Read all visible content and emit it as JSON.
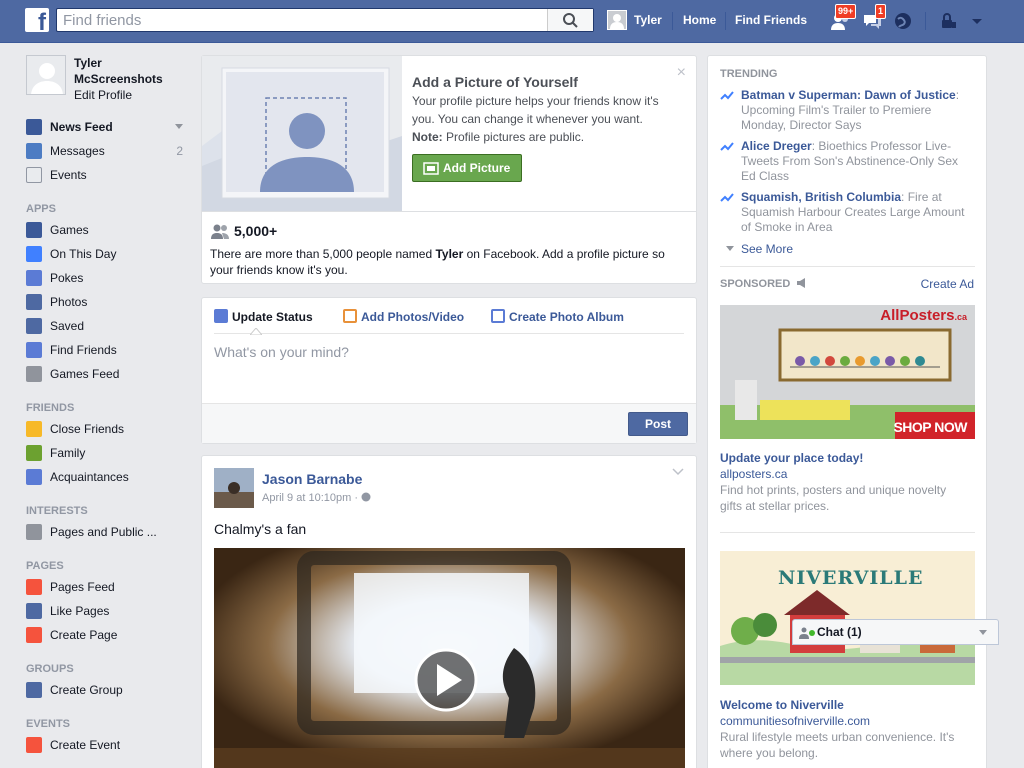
{
  "topbar": {
    "logo": "f",
    "search_placeholder": "Find friends",
    "user": "Tyler",
    "home": "Home",
    "find_friends": "Find Friends",
    "friend_requests_badge": "99+",
    "messages_badge": "1"
  },
  "leftnav": {
    "name": "Tyler McScreenshots",
    "edit_profile": "Edit Profile",
    "favorites": [
      {
        "label": "News Feed",
        "icon": "news-feed-icon",
        "color": "#3b5998"
      },
      {
        "label": "Messages",
        "count": "2",
        "icon": "messages-icon",
        "color": "#4d7cc3"
      },
      {
        "label": "Events",
        "icon": "calendar-icon",
        "color": "#e9ebee"
      }
    ],
    "apps_heading": "APPS",
    "apps": [
      {
        "label": "Games",
        "icon": "games-icon",
        "color": "#3b5998"
      },
      {
        "label": "On This Day",
        "icon": "clock-icon",
        "color": "#4080ff"
      },
      {
        "label": "Pokes",
        "icon": "poke-icon",
        "color": "#5b7bd5"
      },
      {
        "label": "Photos",
        "icon": "photos-icon",
        "color": "#4e69a2"
      },
      {
        "label": "Saved",
        "icon": "bookmark-icon",
        "color": "#4e69a2"
      },
      {
        "label": "Find Friends",
        "icon": "find-friends-icon",
        "color": "#5b7bd5"
      },
      {
        "label": "Games Feed",
        "icon": "gamepad-icon",
        "color": "#90949c"
      }
    ],
    "friends_heading": "FRIENDS",
    "friends": [
      {
        "label": "Close Friends",
        "icon": "star-icon",
        "color": "#f7b928"
      },
      {
        "label": "Family",
        "icon": "family-icon",
        "color": "#6ca130"
      },
      {
        "label": "Acquaintances",
        "icon": "acquaintances-icon",
        "color": "#5b7bd5"
      }
    ],
    "interests_heading": "INTERESTS",
    "interests": [
      {
        "label": "Pages and Public ...",
        "icon": "pages-public-icon",
        "color": "#90949c"
      }
    ],
    "pages_heading": "PAGES",
    "pages": [
      {
        "label": "Pages Feed",
        "icon": "megaphone-icon",
        "color": "#f5533d"
      },
      {
        "label": "Like Pages",
        "icon": "thumbs-up-icon",
        "color": "#4e69a2"
      },
      {
        "label": "Create Page",
        "icon": "plus-page-icon",
        "color": "#f5533d"
      }
    ],
    "groups_heading": "GROUPS",
    "groups": [
      {
        "label": "Create Group",
        "icon": "plus-group-icon",
        "color": "#4e69a2"
      }
    ],
    "events_heading": "EVENTS",
    "events": [
      {
        "label": "Create Event",
        "icon": "plus-event-icon",
        "color": "#f5533d"
      }
    ]
  },
  "addpic": {
    "title": "Add a Picture of Yourself",
    "desc": "Your profile picture helps your friends know it's you. You can change it whenever you want.",
    "note_label": "Note:",
    "note_text": " Profile pictures are public.",
    "button": "Add Picture",
    "close": "×",
    "count": "5,000+",
    "foot_pre": "There are more than 5,000 people named ",
    "foot_name": "Tyler",
    "foot_post": " on Facebook. Add a profile picture so your friends know it's you."
  },
  "composer": {
    "tab_status": "Update Status",
    "tab_photos": "Add Photos/Video",
    "tab_album": "Create Photo Album",
    "placeholder": "What's on your mind?",
    "post": "Post"
  },
  "post": {
    "author": "Jason Barnabe",
    "time": "April 9 at 10:10pm · ",
    "text": "Chalmy's a fan"
  },
  "right": {
    "trending_heading": "TRENDING",
    "trends": [
      {
        "title": "Batman v Superman: Dawn of Justice",
        "desc": ": Upcoming Film's Trailer to Premiere Monday, Director Says"
      },
      {
        "title": "Alice Dreger",
        "desc": ": Bioethics Professor Live-Tweets From Son's Abstinence-Only Sex Ed Class"
      },
      {
        "title": "Squamish, British Columbia",
        "desc": ": Fire at Squamish Harbour Creates Large Amount of Smoke in Area"
      }
    ],
    "see_more": "See More",
    "sponsored": "SPONSORED",
    "create_ad": "Create Ad",
    "ad1": {
      "brand": "AllPosters",
      "brand_suffix": ".ca",
      "cta": "SHOP NOW",
      "title": "Update your place today!",
      "url": "allposters.ca",
      "desc": "Find hot prints, posters and unique novelty gifts at stellar prices."
    },
    "ad2": {
      "banner": "NIVERVILLE",
      "title": "Welcome to Niverville",
      "url": "communitiesofniverville.com",
      "desc": "Rural lifestyle meets urban convenience. It's where you belong."
    }
  },
  "chat": {
    "label": "Chat (1)"
  }
}
